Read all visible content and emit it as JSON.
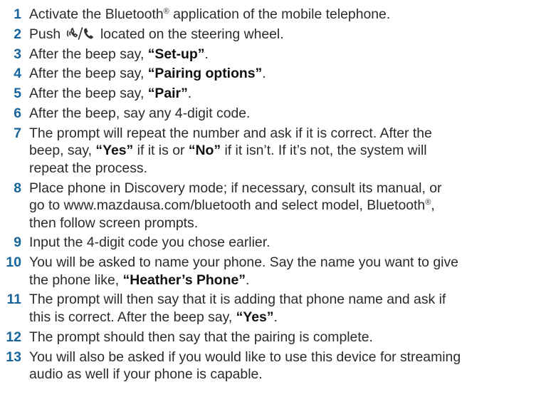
{
  "steps": [
    {
      "num": "1",
      "a": "Activate the Bluetooth",
      "reg": "®",
      "b": " application of the mobile telephone."
    },
    {
      "num": "2",
      "a": "Push ",
      "icon": "talk-button-icon",
      "b": " located on the steering wheel."
    },
    {
      "num": "3",
      "a": "After the beep say, ",
      "cmd": "“Set-up”",
      "b": "."
    },
    {
      "num": "4",
      "a": "After the beep say, ",
      "cmd": "“Pairing options”",
      "b": "."
    },
    {
      "num": "5",
      "a": "After the beep say, ",
      "cmd": "“Pair”",
      "b": "."
    },
    {
      "num": "6",
      "a": "After the beep, say any 4-digit code."
    },
    {
      "num": "7",
      "a": "The prompt will repeat the number and ask if it is correct. After the",
      "a2": "beep, say, ",
      "cmd": "“Yes”",
      "b": " if it is or ",
      "cmd2": "“No”",
      "c": " if it isn’t. If it’s not, the system will",
      "c2": "repeat the process."
    },
    {
      "num": "8",
      "a": "Place phone in Discovery mode; if necessary, consult its manual, or",
      "a2": "go to www.mazdausa.com/bluetooth and select model, Bluetooth",
      "reg": "®",
      "b": ",",
      "b2": "then follow screen prompts."
    },
    {
      "num": "9",
      "a": "Input the 4-digit code you chose earlier."
    },
    {
      "num": "10",
      "a": "You will be asked to name your phone. Say the name you want to give",
      "a2": "the phone like, ",
      "cmd": "“Heather’s Phone”",
      "b": "."
    },
    {
      "num": "11",
      "a": "The prompt will then say that it is adding that phone name and ask if",
      "a2": "this is correct. After the beep say, ",
      "cmd": "“Yes”",
      "b": "."
    },
    {
      "num": "12",
      "a": "The prompt should then say that the pairing is complete."
    },
    {
      "num": "13",
      "a": "You will also be asked if you would like to use this device for streaming",
      "a2": "audio as well if your phone is capable."
    }
  ]
}
